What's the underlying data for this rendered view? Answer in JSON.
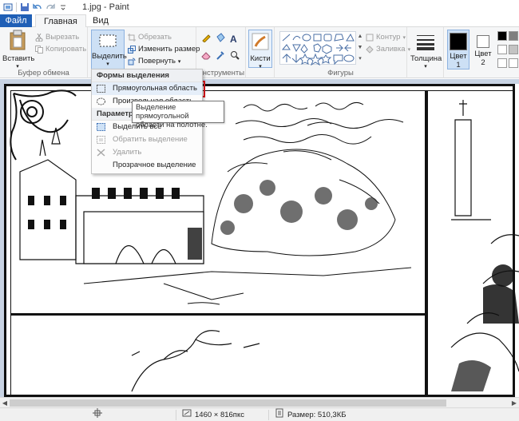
{
  "window": {
    "title": "1.jpg - Paint"
  },
  "tabs": {
    "file": "Файл",
    "home": "Главная",
    "view": "Вид"
  },
  "ribbon": {
    "clipboard": {
      "label": "Буфер обмена",
      "paste": "Вставить",
      "cut": "Вырезать",
      "copy": "Копировать"
    },
    "image": {
      "select": "Выделить",
      "crop": "Обрезать",
      "resize": "Изменить размер",
      "rotate": "Повернуть"
    },
    "tools": {
      "label": "Инструменты"
    },
    "brushes": {
      "label": "Кисти"
    },
    "shapes": {
      "label": "Фигуры",
      "outline": "Контур",
      "fill": "Заливка"
    },
    "thickness": "Толщина",
    "color1": {
      "label": "Цвет",
      "num": "1"
    },
    "color2": {
      "label": "Цвет",
      "num": "2"
    },
    "palette": [
      "#000000",
      "#7f7f7f",
      "#ffffff",
      "#c3c3c3",
      "#ffffff",
      "#ffffff"
    ]
  },
  "dropdown": {
    "header_shapes": "Формы выделения",
    "rect": "Прямоугольная область",
    "free": "Произвольная область",
    "header_params": "Параметры",
    "select_all": "Выделить все",
    "invert": "Обратить выделение",
    "delete": "Удалить",
    "transparent": "Прозрачное выделение"
  },
  "tooltip": {
    "line1": "Выделение прямоугольной",
    "line2": "области на полотне."
  },
  "status": {
    "dimensions": "1460 × 816пкс",
    "size": "Размер: 510,3КБ"
  }
}
